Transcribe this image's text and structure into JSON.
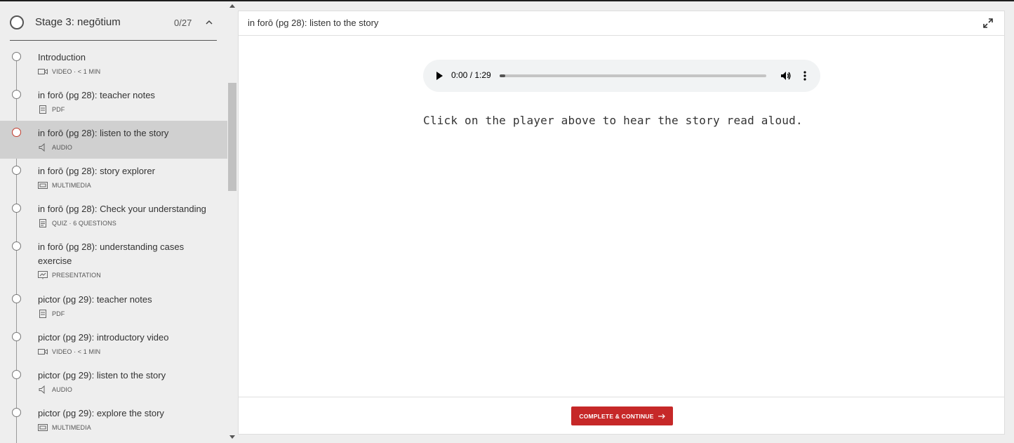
{
  "stage": {
    "title": "Stage 3: negōtium",
    "progress": "0/27"
  },
  "lessons": [
    {
      "title": "Introduction",
      "meta": "VIDEO · < 1 MIN",
      "icon": "video-icon"
    },
    {
      "title": "in forō (pg 28): teacher notes",
      "meta": "PDF",
      "icon": "pdf-icon"
    },
    {
      "title": "in forō (pg 28): listen to the story",
      "meta": "AUDIO",
      "icon": "audio-icon",
      "active": true
    },
    {
      "title": "in forō (pg 28): story explorer",
      "meta": "MULTIMEDIA",
      "icon": "multimedia-icon"
    },
    {
      "title": "in forō (pg 28): Check your understanding",
      "meta": "QUIZ · 6 QUESTIONS",
      "icon": "quiz-icon"
    },
    {
      "title": "in forō (pg 28): understanding cases exercise",
      "meta": "PRESENTATION",
      "icon": "presentation-icon"
    },
    {
      "title": "pictor (pg 29): teacher notes",
      "meta": "PDF",
      "icon": "pdf-icon"
    },
    {
      "title": "pictor (pg 29): introductory video",
      "meta": "VIDEO · < 1 MIN",
      "icon": "video-icon"
    },
    {
      "title": "pictor (pg 29): listen to the story",
      "meta": "AUDIO",
      "icon": "audio-icon"
    },
    {
      "title": "pictor (pg 29): explore the story",
      "meta": "MULTIMEDIA",
      "icon": "multimedia-icon"
    }
  ],
  "content": {
    "title": "in forō (pg 28): listen to the story",
    "audio_time": "0:00 / 1:29",
    "audio_progress": 0.02,
    "story_text": "Click on the player above to hear the story read aloud."
  },
  "footer": {
    "cta_label": "COMPLETE & CONTINUE"
  },
  "colors": {
    "accent": "#c62828",
    "active_row": "#d0d0d0"
  }
}
